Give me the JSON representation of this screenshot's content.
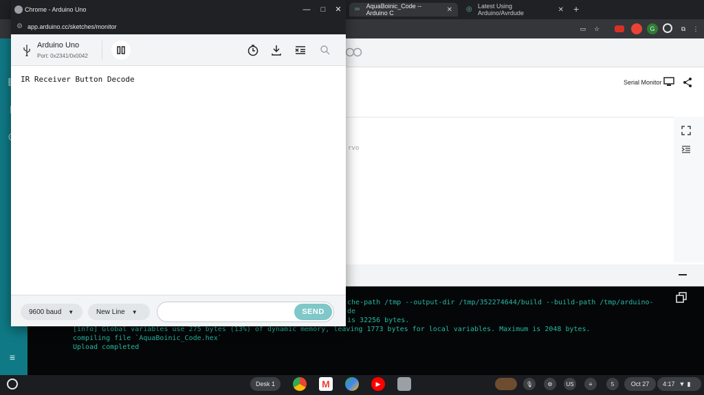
{
  "browser": {
    "tabs": [
      {
        "title": "AquaBoinic_Code -- Arduino C"
      },
      {
        "title": "Latest Using Arduino/Avrdude"
      }
    ],
    "new_tab_glyph": "+"
  },
  "background": {
    "serial_monitor_label": "Serial Monitor",
    "editor_fragment": "rvo",
    "console": {
      "line1": "che-path /tmp --output-dir /tmp/352274644/build --build-path /tmp/arduino-",
      "line2": "de",
      "line3": "is 32256 bytes.",
      "line4": "[info] Global variables use 275 bytes (13%) of dynamic memory, leaving 1773 bytes for local variables. Maximum is 2048 bytes.",
      "line5": "compiling file `AquaBoinic_Code.hex`",
      "line6": "Upload completed"
    }
  },
  "popup": {
    "window_title": "Chrome - Arduino Uno",
    "url": "app.arduino.cc/sketches/monitor",
    "board_name": "Arduino Uno",
    "port": "Port: 0x2341/0x0042",
    "monitor_output": "IR Receiver Button Decode",
    "baud": "9600 baud",
    "line_ending": "New Line",
    "message_placeholder": "",
    "send_label": "SEND"
  },
  "shelf": {
    "desk_label": "Desk 1",
    "notification_count": "5",
    "keyboard_layout": "US",
    "date": "Oct 27",
    "time": "4:17"
  },
  "colors": {
    "accent_teal": "#0f7a86",
    "send_button": "#7fc7c8",
    "console_text": "#27b9a4"
  }
}
